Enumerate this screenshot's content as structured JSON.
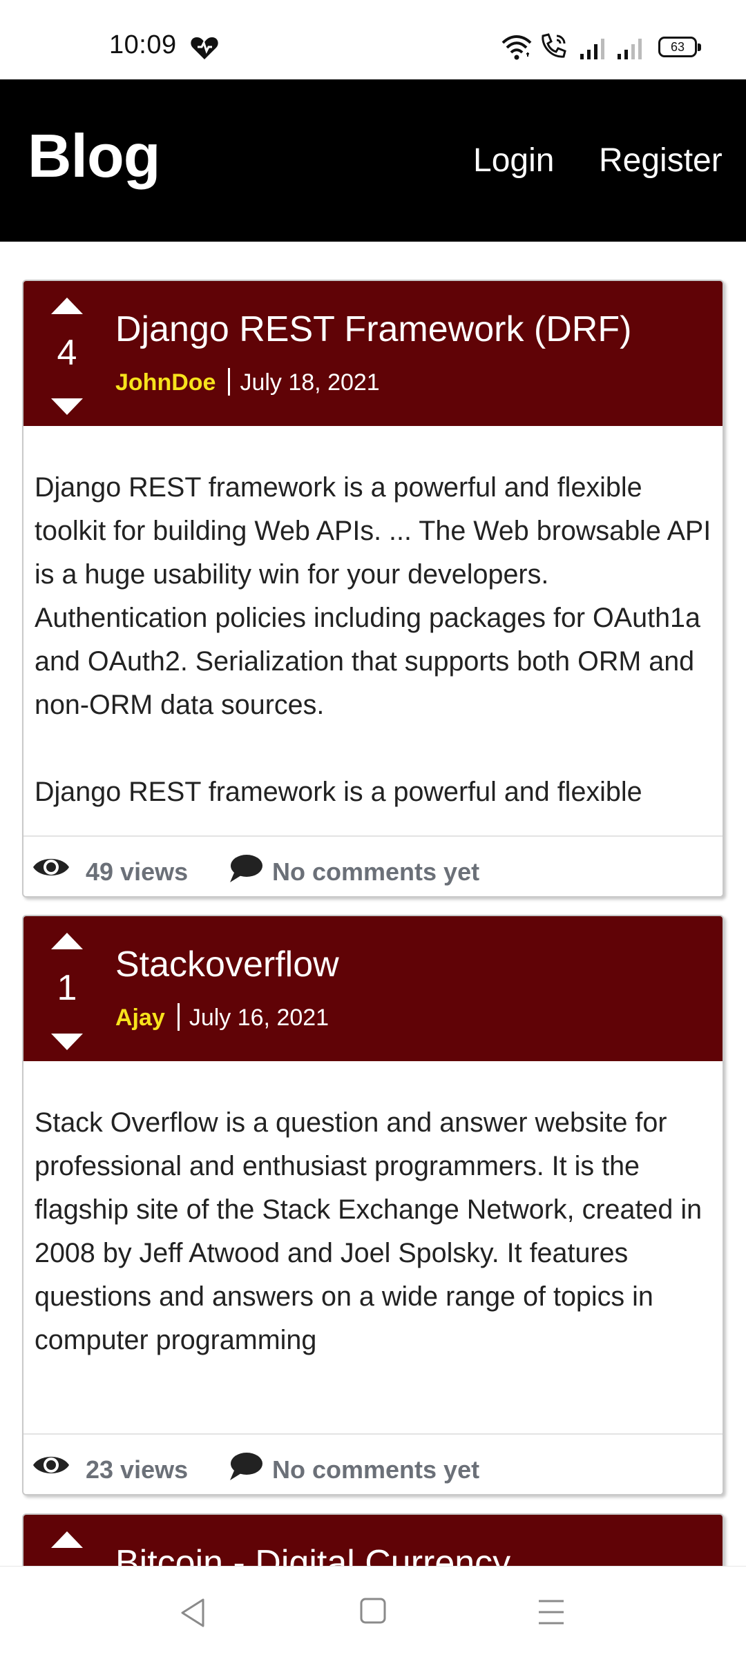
{
  "status": {
    "time": "10:09",
    "battery": "63"
  },
  "navbar": {
    "brand": "Blog",
    "login": "Login",
    "register": "Register"
  },
  "colors": {
    "navbar": "#000000",
    "card_header": "#600306",
    "author": "#f7e31c",
    "footer_text": "#6b7078"
  },
  "posts": [
    {
      "votes": "4",
      "title": "Django REST Framework (DRF)",
      "author": "JohnDoe",
      "date": "July 18, 2021",
      "body": [
        "Django REST framework is a powerful and flexible toolkit for building Web APIs. ... The Web browsable API is a huge usability win for your developers. Authentication policies including packages for OAuth1a and OAuth2. Serialization that supports both ORM and non-ORM data sources.",
        "Django REST framework is a powerful and flexible"
      ],
      "views": "49 views",
      "comments": "No comments yet"
    },
    {
      "votes": "1",
      "title": "Stackoverflow",
      "author": "Ajay",
      "date": "July 16, 2021",
      "body": [
        "Stack Overflow is a question and answer website for professional and enthusiast programmers. It is the flagship site of the Stack Exchange Network, created in 2008 by Jeff Atwood and Joel Spolsky. It features questions and answers on a wide range of topics in computer programming"
      ],
      "views": "23 views",
      "comments": "No comments yet"
    },
    {
      "title": "Bitcoin - Digital Currency"
    }
  ],
  "icons": {
    "heart": "heart-icon",
    "wifi": "wifi-icon",
    "call": "wifi-calling-icon",
    "signal": "signal-icon",
    "battery": "battery-icon",
    "views": "eye-icon",
    "comments": "comment-icon",
    "upvote": "caret-up-icon",
    "downvote": "caret-down-icon",
    "back": "back-triangle-icon",
    "home": "home-square-icon",
    "menu": "menu-lines-icon"
  }
}
